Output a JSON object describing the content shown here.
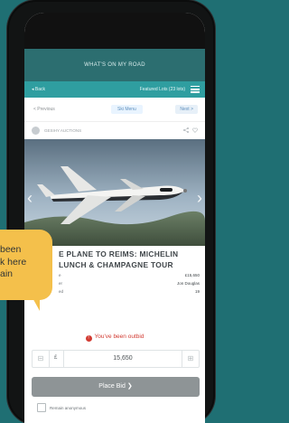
{
  "site_banner": "WHAT'S ON MY ROAD",
  "nav": {
    "left": "◂ Back",
    "right": "Featured Lots (23 lots)"
  },
  "tabs": {
    "prev": "< Previous",
    "center": "Ski Menu",
    "next": "Next >"
  },
  "listing": {
    "seller": "GESIHY AUCTIONS",
    "title_line1": "E PLANE TO REIMS: MICHELIN",
    "title_line2": "LUNCH & CHAMPAGNE TOUR",
    "details": [
      {
        "key": "e",
        "value": "£15,650"
      },
      {
        "key": "er",
        "value": "Jon Douglas"
      },
      {
        "key": "ed",
        "value": "19"
      }
    ]
  },
  "status": {
    "outbid": "You've been outbid"
  },
  "bid": {
    "currency": "£",
    "amount": "15,650",
    "minus": "⊟",
    "plus": "⊞",
    "button_label": "Place Bid ❯"
  },
  "options": {
    "remain_anonymous": "Remain anonymous"
  },
  "tooltip": {
    "line1": "been",
    "line2": "k here",
    "line3": "ain"
  },
  "colors": {
    "background": "#1f6f73",
    "banner": "#2c6e70",
    "nav": "#2f9ea0",
    "outbid": "#d23b32",
    "tooltip": "#f4c04b",
    "button": "#8e9496"
  }
}
